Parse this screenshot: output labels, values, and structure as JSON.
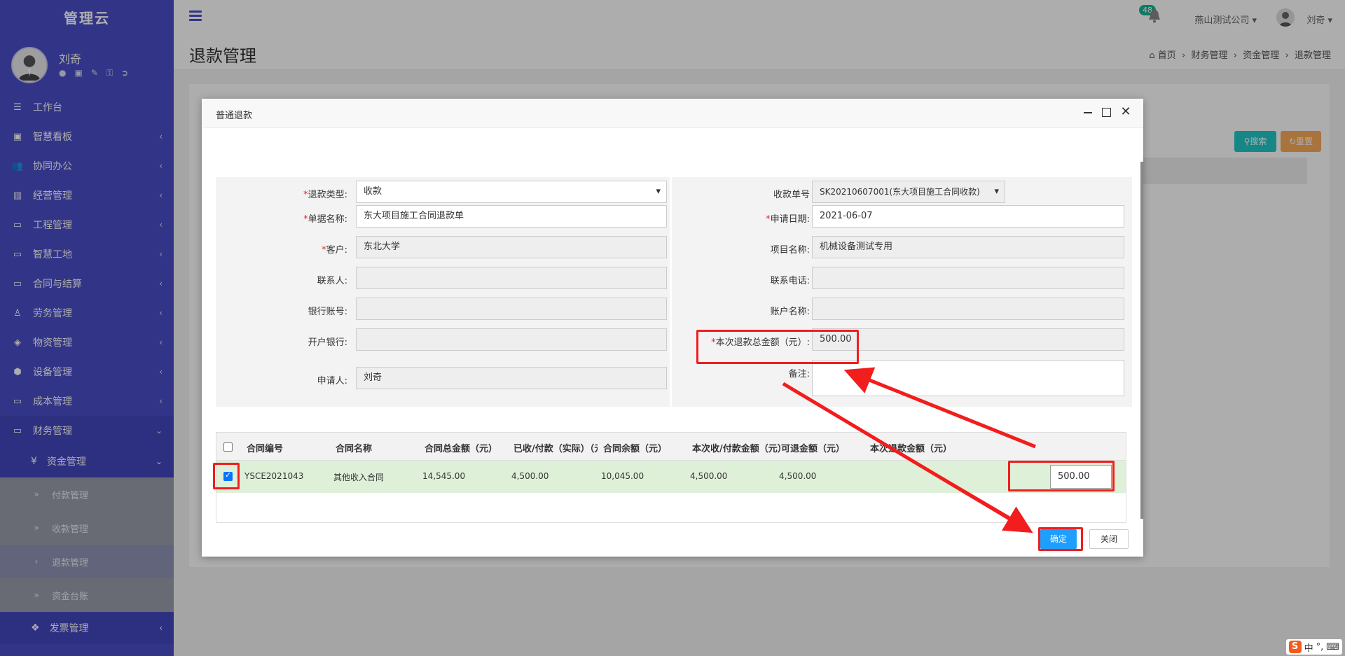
{
  "brand": "管理云",
  "user": {
    "name": "刘奇"
  },
  "topbar": {
    "notify_count": "48",
    "company": "燕山测试公司",
    "user": "刘奇"
  },
  "page": {
    "title": "退款管理",
    "breadcrumb": [
      "首页",
      "财务管理",
      "资金管理",
      "退款管理"
    ],
    "search_label": "搜索",
    "reset_label": "重置"
  },
  "sidebar": {
    "items": [
      {
        "label": "工作台",
        "icon": "desktop-list-icon"
      },
      {
        "label": "智慧看板",
        "icon": "dashboard-icon"
      },
      {
        "label": "协同办公",
        "icon": "users-icon"
      },
      {
        "label": "经营管理",
        "icon": "bar-chart-icon"
      },
      {
        "label": "工程管理",
        "icon": "monitor-icon"
      },
      {
        "label": "智慧工地",
        "icon": "monitor-icon"
      },
      {
        "label": "合同与结算",
        "icon": "monitor-icon"
      },
      {
        "label": "劳务管理",
        "icon": "worker-icon"
      },
      {
        "label": "物资管理",
        "icon": "cube-icon"
      },
      {
        "label": "设备管理",
        "icon": "cubes-icon"
      },
      {
        "label": "成本管理",
        "icon": "monitor-icon"
      },
      {
        "label": "财务管理",
        "icon": "monitor-icon"
      }
    ],
    "fund": "资金管理",
    "fund_subs": [
      "付款管理",
      "收款管理",
      "退款管理",
      "资金台账"
    ],
    "invoice": "发票管理"
  },
  "modal": {
    "title": "普通退款",
    "left": {
      "refund_type": {
        "label": "退款类型:",
        "value": "收款"
      },
      "doc_name": {
        "label": "单据名称:",
        "value": "东大项目施工合同退款单"
      },
      "customer": {
        "label": "客户:",
        "value": "东北大学"
      },
      "contact": {
        "label": "联系人:",
        "value": ""
      },
      "bank_account": {
        "label": "银行账号:",
        "value": ""
      },
      "bank": {
        "label": "开户银行:",
        "value": ""
      },
      "applicant": {
        "label": "申请人:",
        "value": "刘奇"
      }
    },
    "right": {
      "receipt_no": {
        "label": "收款单号",
        "value": "SK20210607001(东大项目施工合同收款)"
      },
      "apply_date": {
        "label": "申请日期:",
        "value": "2021-06-07"
      },
      "project": {
        "label": "项目名称:",
        "value": "机械设备测试专用"
      },
      "phone": {
        "label": "联系电话:",
        "value": ""
      },
      "account_name": {
        "label": "账户名称:",
        "value": ""
      },
      "total": {
        "label": "本次退款总金额（元）:",
        "value": "500.00"
      },
      "remark": {
        "label": "备注:",
        "value": ""
      }
    },
    "table": {
      "headers": [
        "合同编号",
        "合同名称",
        "合同总金额（元）",
        "已收/付款（实际）（元",
        "合同余额（元）",
        "本次收/付款金额（元）",
        "可退金额（元）",
        "本次退款金额（元）"
      ],
      "rows": [
        {
          "checked": true,
          "cells": [
            "YSCE2021043",
            "其他收入合同",
            "14,545.00",
            "4,500.00",
            "10,045.00",
            "4,500.00",
            "4,500.00"
          ],
          "refund": "500.00"
        }
      ]
    },
    "ok_label": "确定",
    "close_label": "关闭"
  },
  "ime": {
    "lang": "中"
  },
  "colors": {
    "sidebar": "#4a4ec7",
    "primary": "#1e9fff",
    "annotation": "#f21d1d",
    "row_selected": "#dff0d8"
  }
}
